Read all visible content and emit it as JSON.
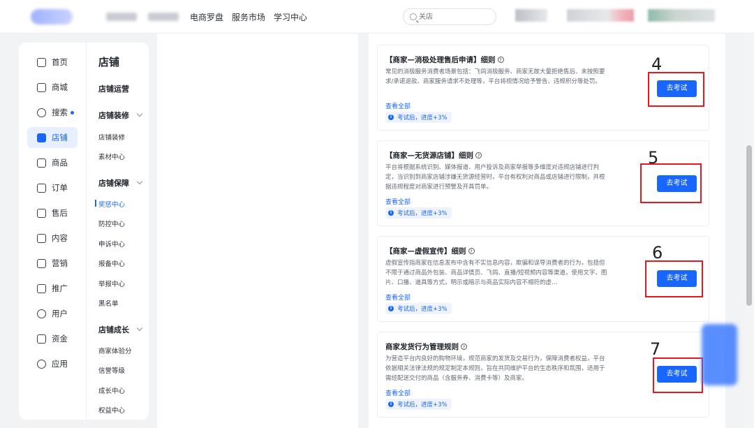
{
  "topnav": {
    "links": [
      "电商罗盘",
      "服务市场",
      "学习中心"
    ],
    "search_placeholder": "关店"
  },
  "sidebar": {
    "items": [
      {
        "label": "首页",
        "icon": "home-icon"
      },
      {
        "label": "商城",
        "icon": "store-icon"
      },
      {
        "label": "搜索",
        "icon": "search-icon"
      },
      {
        "label": "店铺",
        "icon": "shop-icon"
      },
      {
        "label": "商品",
        "icon": "product-icon"
      },
      {
        "label": "订单",
        "icon": "order-icon"
      },
      {
        "label": "售后",
        "icon": "aftersale-icon"
      },
      {
        "label": "内容",
        "icon": "content-icon"
      },
      {
        "label": "营销",
        "icon": "marketing-icon"
      },
      {
        "label": "推广",
        "icon": "promotion-icon"
      },
      {
        "label": "用户",
        "icon": "user-icon"
      },
      {
        "label": "资金",
        "icon": "funds-icon"
      },
      {
        "label": "应用",
        "icon": "apps-icon"
      }
    ],
    "active": "店铺"
  },
  "subnav": {
    "title": "店铺",
    "groups": [
      {
        "label": "店铺运营",
        "items": []
      },
      {
        "label": "店铺装修",
        "items": [
          "店铺装修",
          "素材中心"
        ]
      },
      {
        "label": "店铺保障",
        "items": [
          "奖惩中心",
          "防控中心",
          "申诉中心",
          "报备中心",
          "举报中心",
          "黑名单"
        ]
      },
      {
        "label": "店铺成长",
        "items": [
          "商家体验分",
          "信誉等级",
          "成长中心",
          "权益中心"
        ]
      }
    ],
    "active_item": "奖惩中心"
  },
  "cards": [
    {
      "title": "【商家—消极处理售后申请】细则",
      "desc": "常见的消极服务消费者场景包括：飞鸽消极服务、商家无故大量拒绝售后、未按照要求/承诺退款、商家服务请求不处理等，平台将视情况给予警告、违规积分等处罚。",
      "link": "查看全部",
      "badge": "考试后，进度+3%",
      "button": "去考试",
      "annotation": "4"
    },
    {
      "title": "【商家—无货源店铺】细则",
      "desc": "平台将根据系统识别、媒体报道、用户投诉及商家举报等多维度对违规店铺进行判定，当识别到商家店铺涉嫌无货源经营时，平台有权利对商品或店铺进行限制，并根据违规程度对商家进行预警及开具罚单。",
      "link": "查看全部",
      "badge": "考试后，进度+3%",
      "button": "去考试",
      "annotation": "5"
    },
    {
      "title": "【商家—虚假宣传】细则",
      "desc": "虚假宣传指商家在信息发布中含有不实信息内容，欺骗和误导消费者的行为，包括但不限于通过商品外包装、商品详情页、飞鸽、直播/短视频内容等渠道，使用文字、图片、口播、道具等方式，明示或暗示与商品实际内容不相符的虚…",
      "link": "查看全部",
      "badge": "考试后，进度+3%",
      "button": "去考试",
      "annotation": "6"
    },
    {
      "title": "商家发货行为管理规则",
      "desc": "为营造平台内良好的购物环境，规范商家的发货及交易行为，保障消费者权益，平台依据相关法律法规的规定制定本规则，旨在共同维护平台的生态秩序和氛围，适用于需经配送交付的商品（含服务券、消费卡等）及商家。",
      "link": "查看全部",
      "badge": "考试后，进度+3%",
      "button": "去考试",
      "annotation": "7"
    }
  ],
  "colors": {
    "accent": "#1966ff",
    "highlight_box": "#e8171d",
    "active_bg": "#e8efff"
  }
}
